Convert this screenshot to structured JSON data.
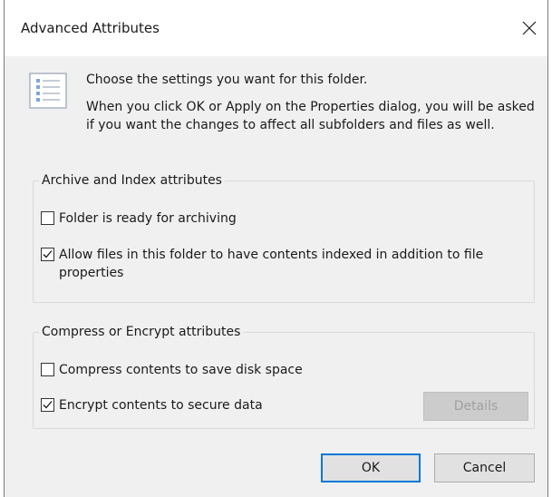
{
  "dialog": {
    "title": "Advanced Attributes",
    "close_icon": "close-icon"
  },
  "header": {
    "icon": "folder-settings-icon",
    "line1": "Choose the settings you want for this folder.",
    "line2": "When you click OK or Apply on the Properties dialog, you will be asked if you want the changes to affect all subfolders and files as well."
  },
  "archive_group": {
    "label": "Archive and Index attributes",
    "options": [
      {
        "label": "Folder is ready for archiving",
        "checked": false
      },
      {
        "label": "Allow files in this folder to have contents indexed in addition to file properties",
        "checked": true
      }
    ]
  },
  "compress_group": {
    "label": "Compress or Encrypt attributes",
    "options": [
      {
        "label": "Compress contents to save disk space",
        "checked": false
      },
      {
        "label": "Encrypt contents to secure data",
        "checked": true
      }
    ],
    "details_label": "Details",
    "details_enabled": false
  },
  "buttons": {
    "ok_label": "OK",
    "cancel_label": "Cancel"
  },
  "colors": {
    "dialog_bg": "#f0f0f0",
    "accent": "#0078d7",
    "disabled_text": "#a0a0a0"
  }
}
